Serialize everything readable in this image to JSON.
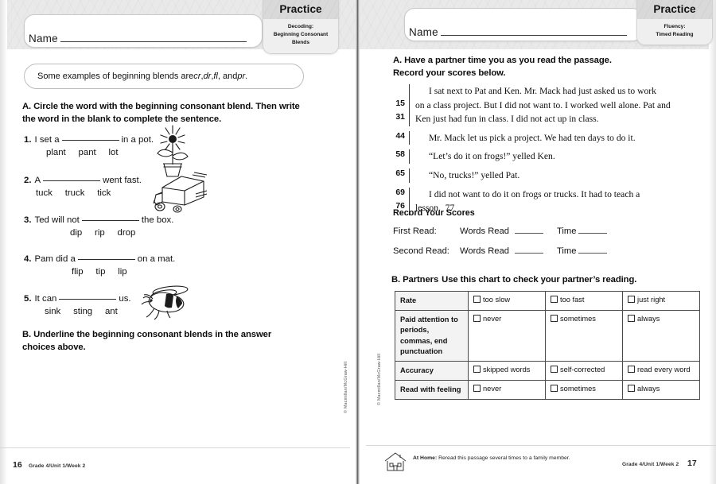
{
  "left_page": {
    "name_label": "Name",
    "tab": {
      "title": "Practice",
      "subtitle_line1": "Decoding:",
      "subtitle_line2": "Beginning Consonant",
      "subtitle_line3": "Blends"
    },
    "callout": {
      "text_before": "Some examples of beginning blends are ",
      "blend1": "cr",
      "sep1": ", ",
      "blend2": "dr",
      "sep2": ", ",
      "blend3": "fl",
      "sep3": ", and ",
      "blend4": "pr",
      "text_after": "."
    },
    "section_a": {
      "letter": "A.",
      "instruction_line1": "Circle the word with the beginning consonant blend. Then write",
      "instruction_line2": "the word in the blank to complete the sentence."
    },
    "items": [
      {
        "num": "1.",
        "before": "I set a",
        "after": "in a pot.",
        "choices": "plant     pant     lot",
        "art": "flower-pot"
      },
      {
        "num": "2.",
        "before": "A",
        "after": "went fast.",
        "choices": "tuck     truck     tick",
        "art": "truck"
      },
      {
        "num": "3.",
        "before": "Ted will not",
        "after": "the box.",
        "choices": "dip     rip     drop",
        "art": ""
      },
      {
        "num": "4.",
        "before": "Pam did a",
        "after": "on a mat.",
        "choices": "flip     tip     lip",
        "art": ""
      },
      {
        "num": "5.",
        "before": "It can",
        "after": "us.",
        "choices": "sink     sting     ant",
        "art": "bee"
      }
    ],
    "section_b": {
      "letter": "B.",
      "instruction_line1": "Underline the beginning consonant blends in the answer",
      "instruction_line2": "choices above."
    },
    "copyright": "© Macmillan/McGraw-Hill",
    "footer": {
      "page_number": "16",
      "info": "Grade 4/Unit 1/Week 2"
    }
  },
  "right_page": {
    "name_label": "Name",
    "tab": {
      "title": "Practice",
      "subtitle_line1": "Fluency:",
      "subtitle_line2": "Timed Reading",
      "subtitle_line3": ""
    },
    "section_a": {
      "letter": "A.",
      "instruction_line1": "Have a partner time you as you read the passage.",
      "instruction_line2": "Record your scores below."
    },
    "passage": [
      {
        "num": "",
        "text": "I sat next to Pat and Ken. Mr. Mack had just asked us to work",
        "indent": true
      },
      {
        "num": "15",
        "text": "on a class project. But I did not want to. I worked well alone. Pat and",
        "indent": false
      },
      {
        "num": "31",
        "text": "Ken just had fun in class. I did not act up in class.",
        "indent": false
      },
      {
        "num": "44",
        "text": "Mr. Mack let us pick a project. We had ten days to do it.",
        "indent": true
      },
      {
        "num": "58",
        "text": "“Let’s do it on frogs!” yelled Ken.",
        "indent": true
      },
      {
        "num": "65",
        "text": "“No, trucks!” yelled Pat.",
        "indent": true
      },
      {
        "num": "69",
        "text": "I did not want to do it on frogs or trucks. It had to teach a",
        "indent": true
      },
      {
        "num": "76",
        "text": "lesson.  77",
        "indent": false
      }
    ],
    "record_scores": {
      "title": "Record Your Scores",
      "rows": [
        {
          "label": "First Read:",
          "words_read": "Words Read",
          "time": "Time"
        },
        {
          "label": "Second Read:",
          "words_read": "Words Read",
          "time": "Time"
        }
      ]
    },
    "section_b": {
      "letter": "B.",
      "bold_word": "Partners",
      "instruction": "Use this chart to check your partner’s reading."
    },
    "partners_table": [
      {
        "category": "Rate",
        "options": [
          "too slow",
          "too fast",
          "just right"
        ]
      },
      {
        "category": "Paid attention to periods, commas, end punctuation",
        "options": [
          "never",
          "sometimes",
          "always"
        ]
      },
      {
        "category": "Accuracy",
        "options": [
          "skipped words",
          "self-corrected",
          "read every word"
        ]
      },
      {
        "category": "Read with feeling",
        "options": [
          "never",
          "sometimes",
          "always"
        ]
      }
    ],
    "at_home": {
      "label": "At Home:",
      "text": "Reread this passage several times to a family member.",
      "icon": "house-icon"
    },
    "copyright": "© Macmillan/McGraw-Hill",
    "footer": {
      "page_number": "17",
      "info": "Grade 4/Unit 1/Week 2"
    }
  }
}
